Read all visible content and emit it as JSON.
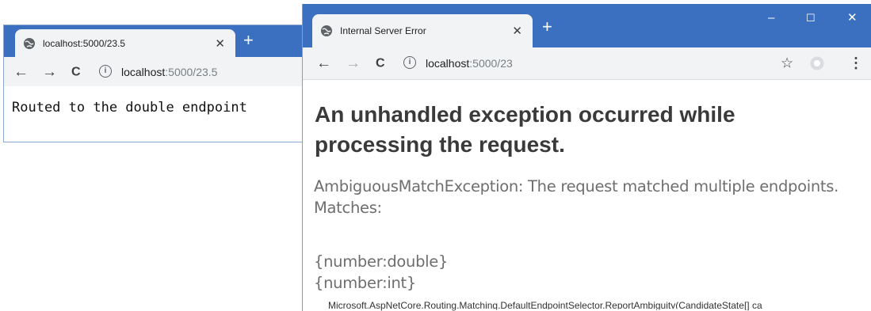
{
  "window_back": {
    "tab_title": "localhost:5000/23.5",
    "tab_close": "✕",
    "new_tab": "+",
    "nav": {
      "back": "←",
      "forward": "→",
      "reload": "C"
    },
    "address": {
      "info": "i",
      "host": "localhost",
      "path": ":5000/23.5"
    },
    "body_text": "Routed to the double endpoint"
  },
  "window_front": {
    "tab_title": "Internal Server Error",
    "tab_close": "✕",
    "new_tab": "+",
    "controls": {
      "minimize": "–",
      "maximize": "☐",
      "close": "✕"
    },
    "nav": {
      "back": "←",
      "forward": "→",
      "reload": "C"
    },
    "address": {
      "info": "i",
      "host": "localhost",
      "path": ":5000/23"
    },
    "toolbar_icons": {
      "star": "☆",
      "menu": "⋮"
    },
    "heading": "An unhandled exception occurred while processing the request.",
    "exception_line1": "AmbiguousMatchException: The request matched multiple endpoints.",
    "exception_line2": "Matches:",
    "matches": [
      "{number:double}",
      "{number:int}"
    ],
    "stack_trace": "Microsoft.AspNetCore.Routing.Matching.DefaultEndpointSelector.ReportAmbiguity(CandidateState[] ca"
  },
  "colors": {
    "chrome_blue": "#3b6fc0",
    "toolbar_gray": "#f1f3f4",
    "heading_text": "#3a3a3a",
    "exception_text": "#6e6e6e"
  },
  "icons": [
    "globe-icon",
    "close-icon",
    "plus-icon",
    "back-arrow-icon",
    "forward-arrow-icon",
    "reload-icon",
    "info-icon",
    "star-icon",
    "profile-icon",
    "kebab-menu-icon",
    "minimize-icon",
    "maximize-icon"
  ]
}
